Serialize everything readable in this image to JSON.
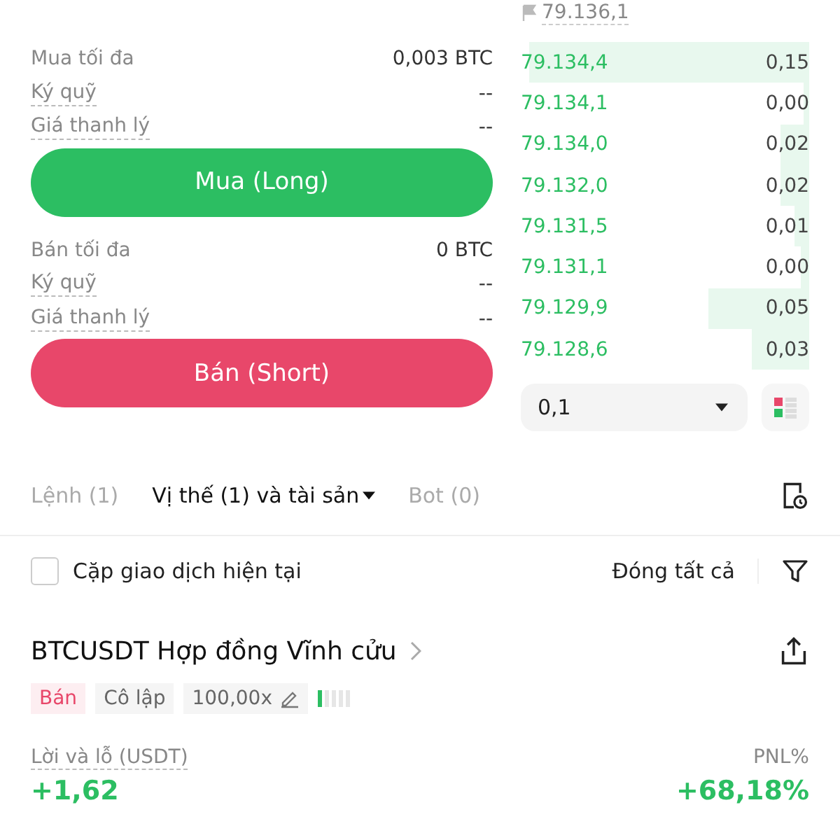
{
  "buy": {
    "rows": [
      {
        "label": "Mua tối đa",
        "value": "0,003 BTC",
        "dashed": false
      },
      {
        "label": "Ký quỹ",
        "value": "--",
        "dashed": true
      },
      {
        "label": "Giá thanh lý",
        "value": "--",
        "dashed": true
      }
    ],
    "button": "Mua (Long)"
  },
  "sell": {
    "rows": [
      {
        "label": "Bán tối đa",
        "value": "0 BTC",
        "dashed": false
      },
      {
        "label": "Ký quỹ",
        "value": "--",
        "dashed": true
      },
      {
        "label": "Giá thanh lý",
        "value": "--",
        "dashed": true
      }
    ],
    "button": "Bán (Short)"
  },
  "order_book": {
    "mark_price": "79.136,1",
    "rows": [
      {
        "price": "79.134,4",
        "amount": "0,15"
      },
      {
        "price": "79.134,1",
        "amount": "0,00"
      },
      {
        "price": "79.134,0",
        "amount": "0,02"
      },
      {
        "price": "79.132,0",
        "amount": "0,02"
      },
      {
        "price": "79.131,5",
        "amount": "0,01"
      },
      {
        "price": "79.131,1",
        "amount": "0,00"
      },
      {
        "price": "79.129,9",
        "amount": "0,05"
      },
      {
        "price": "79.128,6",
        "amount": "0,03"
      }
    ],
    "precision": "0,1"
  },
  "tabs": [
    {
      "label": "Lệnh (1)",
      "selected": false,
      "dropdown": false
    },
    {
      "label": "Vị thế (1) và tài sản",
      "selected": true,
      "dropdown": true
    },
    {
      "label": "Bot (0)",
      "selected": false,
      "dropdown": false
    }
  ],
  "filter": {
    "label": "Cặp giao dịch hiện tại",
    "checked": false,
    "close_all": "Đóng tất cả"
  },
  "position": {
    "title": "BTCUSDT Hợp đồng Vĩnh cửu",
    "side": "Bán",
    "margin_mode": "Cô lập",
    "leverage": "100,00x",
    "risk": {
      "level": 0.2
    },
    "pnl_label": "Lời và lỗ (USDT)",
    "pnl": "+1,62",
    "pnl_pct_label": "PNL%",
    "pnl_pct": "+68,18%"
  }
}
